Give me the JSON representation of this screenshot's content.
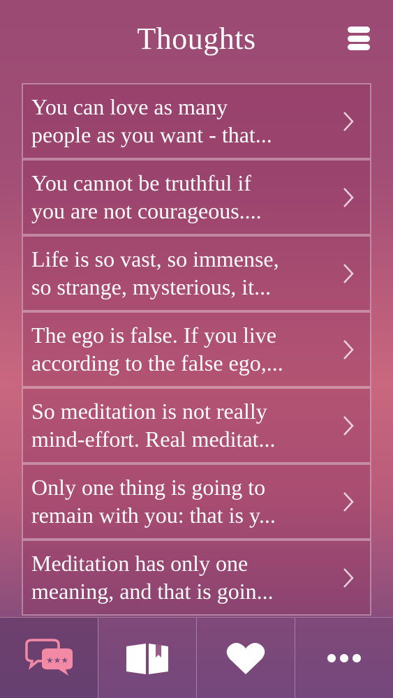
{
  "header": {
    "title": "Thoughts",
    "menu_icon": "hamburger-menu-icon"
  },
  "thoughts": [
    {
      "line1": "You can love as many",
      "line2": "people as you want - that..."
    },
    {
      "line1": "You cannot be truthful if",
      "line2": "you are not courageous...."
    },
    {
      "line1": "Life is so vast, so immense,",
      "line2": "so strange, mysterious, it..."
    },
    {
      "line1": "The ego is false. If you live",
      "line2": "according to the false ego,..."
    },
    {
      "line1": "So meditation is not really",
      "line2": "mind-effort. Real meditat..."
    },
    {
      "line1": "Only one thing is going to",
      "line2": "remain with you: that is y..."
    },
    {
      "line1": "Meditation has only one",
      "line2": "meaning, and that is goin..."
    }
  ],
  "tabbar": {
    "tabs": [
      {
        "icon": "chat-bubbles-icon",
        "active": true,
        "active_color": "#f28aa5"
      },
      {
        "icon": "book-icon",
        "active": false
      },
      {
        "icon": "heart-icon",
        "active": false
      },
      {
        "icon": "more-icon",
        "active": false
      }
    ]
  }
}
